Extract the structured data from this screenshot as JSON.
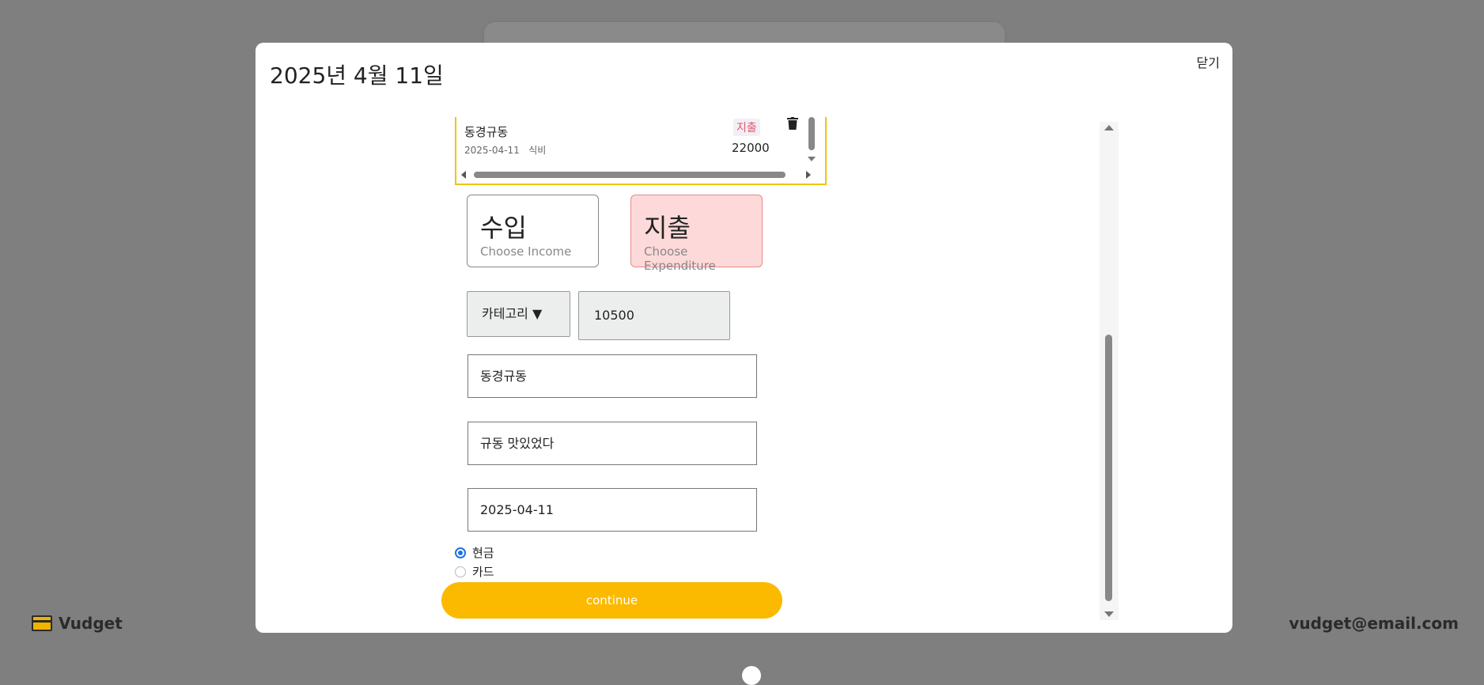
{
  "background": {
    "brand": "Vudget",
    "email": "vudget@email.com"
  },
  "modal": {
    "title": "2025년 4월 11일",
    "close_label": "닫기"
  },
  "transaction": {
    "title": "동경규동",
    "date": "2025-04-11",
    "category": "식비",
    "type": "지출",
    "amount": "22000"
  },
  "type_choice": {
    "income_label": "수입",
    "income_sub": "Choose Income",
    "expense_label": "지출",
    "expense_sub": "Choose Expenditure",
    "selected": "expense"
  },
  "form": {
    "category_label": "카테고리 ▼",
    "amount_value": "10500",
    "name_value": "동경규동",
    "memo_value": "규동 맛있었다",
    "date_value": "2025-04-11",
    "payment_options": [
      {
        "label": "현금",
        "checked": true
      },
      {
        "label": "카드",
        "checked": false
      }
    ],
    "continue_label": "continue"
  },
  "colors": {
    "overlay": "#7f7f7f",
    "accent": "#fbb900",
    "expense_bg": "#fdd9d9",
    "expense_text": "#e05a6a",
    "radio_selected": "#1a73e8"
  }
}
